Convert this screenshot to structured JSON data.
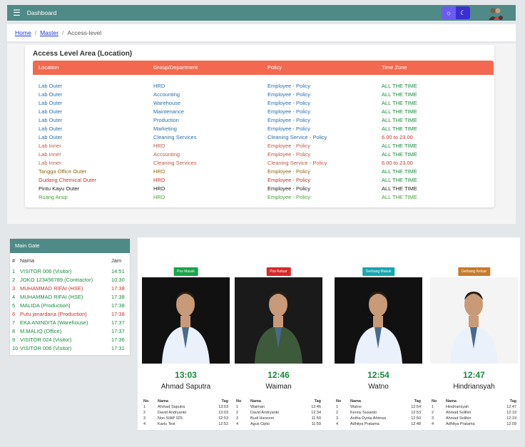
{
  "header": {
    "menu_icon": "☰",
    "title": "Dashboard",
    "theme_toggle": {
      "light_icon": "☼",
      "dark_icon": "☾"
    }
  },
  "breadcrumb": {
    "items": [
      "Home",
      "Master",
      "Access-level"
    ],
    "separator": "/"
  },
  "access_card": {
    "title": "Access Level Area (Location)",
    "columns": [
      "Location",
      "Group/Department",
      "Policy",
      "Time Zone"
    ],
    "rows": [
      {
        "location": "Lab Outer",
        "group": "HRD",
        "policy": "Employee - Policy",
        "time_zone": "ALL THE TIME",
        "color": "#2b6fa8",
        "tz_color": "#1a8a3e"
      },
      {
        "location": "Lab Outer",
        "group": "Accounting",
        "policy": "Employee - Policy",
        "time_zone": "ALL THE TIME",
        "color": "#2b6fa8",
        "tz_color": "#1a8a3e"
      },
      {
        "location": "Lab Outer",
        "group": "Warehouse",
        "policy": "Employee - Policy",
        "time_zone": "ALL THE TIME",
        "color": "#2b6fa8",
        "tz_color": "#1a8a3e"
      },
      {
        "location": "Lab Outer",
        "group": "Maintenance",
        "policy": "Employee - Policy",
        "time_zone": "ALL THE TIME",
        "color": "#2b6fa8",
        "tz_color": "#1a8a3e"
      },
      {
        "location": "Lab Outer",
        "group": "Production",
        "policy": "Employee - Policy",
        "time_zone": "ALL THE TIME",
        "color": "#2b6fa8",
        "tz_color": "#1a8a3e"
      },
      {
        "location": "Lab Outer",
        "group": "Marketing",
        "policy": "Employee - Policy",
        "time_zone": "ALL THE TIME",
        "color": "#2b6fa8",
        "tz_color": "#1a8a3e"
      },
      {
        "location": "Lab Outer",
        "group": "Cleaning Services",
        "policy": "Cleaning Service - Policy",
        "time_zone": "6.00 to 23.00",
        "color": "#2b6fa8",
        "tz_color": "#c9322a"
      },
      {
        "location": "Lab Inner",
        "group": "HRD",
        "policy": "Employee - Policy",
        "time_zone": "ALL THE TIME",
        "color": "#b85a4a",
        "tz_color": "#1a8a3e"
      },
      {
        "location": "Lab Inner",
        "group": "Accounting",
        "policy": "Employee - Policy",
        "time_zone": "ALL THE TIME",
        "color": "#b85a4a",
        "tz_color": "#1a8a3e"
      },
      {
        "location": "Lab Inner",
        "group": "Cleaning Services",
        "policy": "Cleaning Service - Policy",
        "time_zone": "6.00 to 23.00",
        "color": "#b85a4a",
        "tz_color": "#c9322a"
      },
      {
        "location": "Tangga Office Outer",
        "group": "HRD",
        "policy": "Employee - Policy",
        "time_zone": "ALL THE TIME",
        "color": "#8a6a10",
        "tz_color": "#1a8a3e"
      },
      {
        "location": "Gudang Chemical Outer",
        "group": "HRD",
        "policy": "Employee - Policy",
        "time_zone": "ALL THE TIME",
        "color": "#c9322a",
        "tz_color": "#1a8a3e"
      },
      {
        "location": "Pintu Kayu Outer",
        "group": "HRD",
        "policy": "Employee - Policy",
        "time_zone": "ALL THE TIME",
        "color": "#222222",
        "tz_color": "#222222"
      },
      {
        "location": "Ruang Arsip",
        "group": "HRD",
        "policy": "Employee - Policy",
        "time_zone": "ALL THE TIME",
        "color": "#4aa03a",
        "tz_color": "#4aa03a"
      }
    ]
  },
  "main_gate": {
    "title": "Main Gate",
    "columns": [
      "#",
      "Nama",
      "Jam"
    ],
    "rows": [
      {
        "no": "1",
        "name": "VISITOR 006 (Visitor)",
        "time": "14:51",
        "color": "#1a8a3e"
      },
      {
        "no": "2",
        "name": "JOKO 123456789 (Contractor)",
        "time": "10:30",
        "color": "#1a8a3e"
      },
      {
        "no": "3",
        "name": "MUHAMMAD RIFAI (HSE)",
        "time": "17:38",
        "color": "#c9322a"
      },
      {
        "no": "4",
        "name": "MUHAMMAD RIFAI (HSE)",
        "time": "17:38",
        "color": "#1a8a3e"
      },
      {
        "no": "5",
        "name": "MALIDA (Production)",
        "time": "17:38",
        "color": "#1a8a3e"
      },
      {
        "no": "6",
        "name": "Putu janardana (Production)",
        "time": "17:38",
        "color": "#c9322a"
      },
      {
        "no": "7",
        "name": "EKA ANINDITA (Warehouse)",
        "time": "17:37",
        "color": "#1a8a3e"
      },
      {
        "no": "8",
        "name": "M.MALIQ (Office)",
        "time": "17:37",
        "color": "#1a8a3e"
      },
      {
        "no": "9",
        "name": "VISITOR 024 (Visitor)",
        "time": "17:36",
        "color": "#1a8a3e"
      },
      {
        "no": "10",
        "name": "VISITOR 006 (Visitor)",
        "time": "17:31",
        "color": "#1a8a3e"
      }
    ]
  },
  "gates": [
    {
      "label": "Pos Masuk",
      "badge_color": "#1aa34a",
      "time": "13:03",
      "name": "Ahmad Saputra",
      "photo_bg": "#111111",
      "shirt": "#eaf1fb",
      "cols": [
        "No",
        "Nama",
        "Tag"
      ],
      "list": [
        [
          "1",
          "Ahmad Saputra",
          "13:03"
        ],
        [
          "2",
          "David Andryanto",
          "13:03"
        ],
        [
          "3",
          "Non SIAP 025",
          "12:53"
        ],
        [
          "4",
          "Kartu Test",
          "12:52"
        ]
      ]
    },
    {
      "label": "Pos Keluar",
      "badge_color": "#d8282a",
      "time": "12:46",
      "name": "Waiman",
      "photo_bg": "#1a1a1a",
      "shirt": "#3d5a3a",
      "cols": [
        "No",
        "Nama",
        "Tag"
      ],
      "list": [
        [
          "1",
          "Waiman",
          "12:46"
        ],
        [
          "2",
          "David Andryanto",
          "12:34"
        ],
        [
          "3",
          "Budi Harsono",
          "11:59"
        ],
        [
          "4",
          "Agus Cipto",
          "11:59"
        ]
      ]
    },
    {
      "label": "Gerbang Masuk",
      "badge_color": "#17a6b0",
      "time": "12:54",
      "name": "Watno",
      "photo_bg": "#111111",
      "shirt": "#eaf1fb",
      "cols": [
        "No",
        "Nama",
        "Tag"
      ],
      "list": [
        [
          "1",
          "Watno",
          "12:54"
        ],
        [
          "2",
          "Kenny Susanto",
          "12:53"
        ],
        [
          "3",
          "Ardha Dyota Ahimsa",
          "12:50"
        ],
        [
          "4",
          "Adhitya Pratama",
          "12:48"
        ]
      ]
    },
    {
      "label": "Gerbang Keluar",
      "badge_color": "#c87b2a",
      "time": "12:47",
      "name": "Hindriansyah",
      "photo_bg": "#f4f4f4",
      "shirt": "#eaf1fb",
      "cols": [
        "No",
        "Nama",
        "Tag"
      ],
      "list": [
        [
          "1",
          "Hindriansyah",
          "12:47"
        ],
        [
          "2",
          "Ahmad Solihin",
          "12:19"
        ],
        [
          "3",
          "Ahmad Solihin",
          "12:19"
        ],
        [
          "4",
          "Adhitya Pratama",
          "12:09"
        ]
      ]
    }
  ]
}
